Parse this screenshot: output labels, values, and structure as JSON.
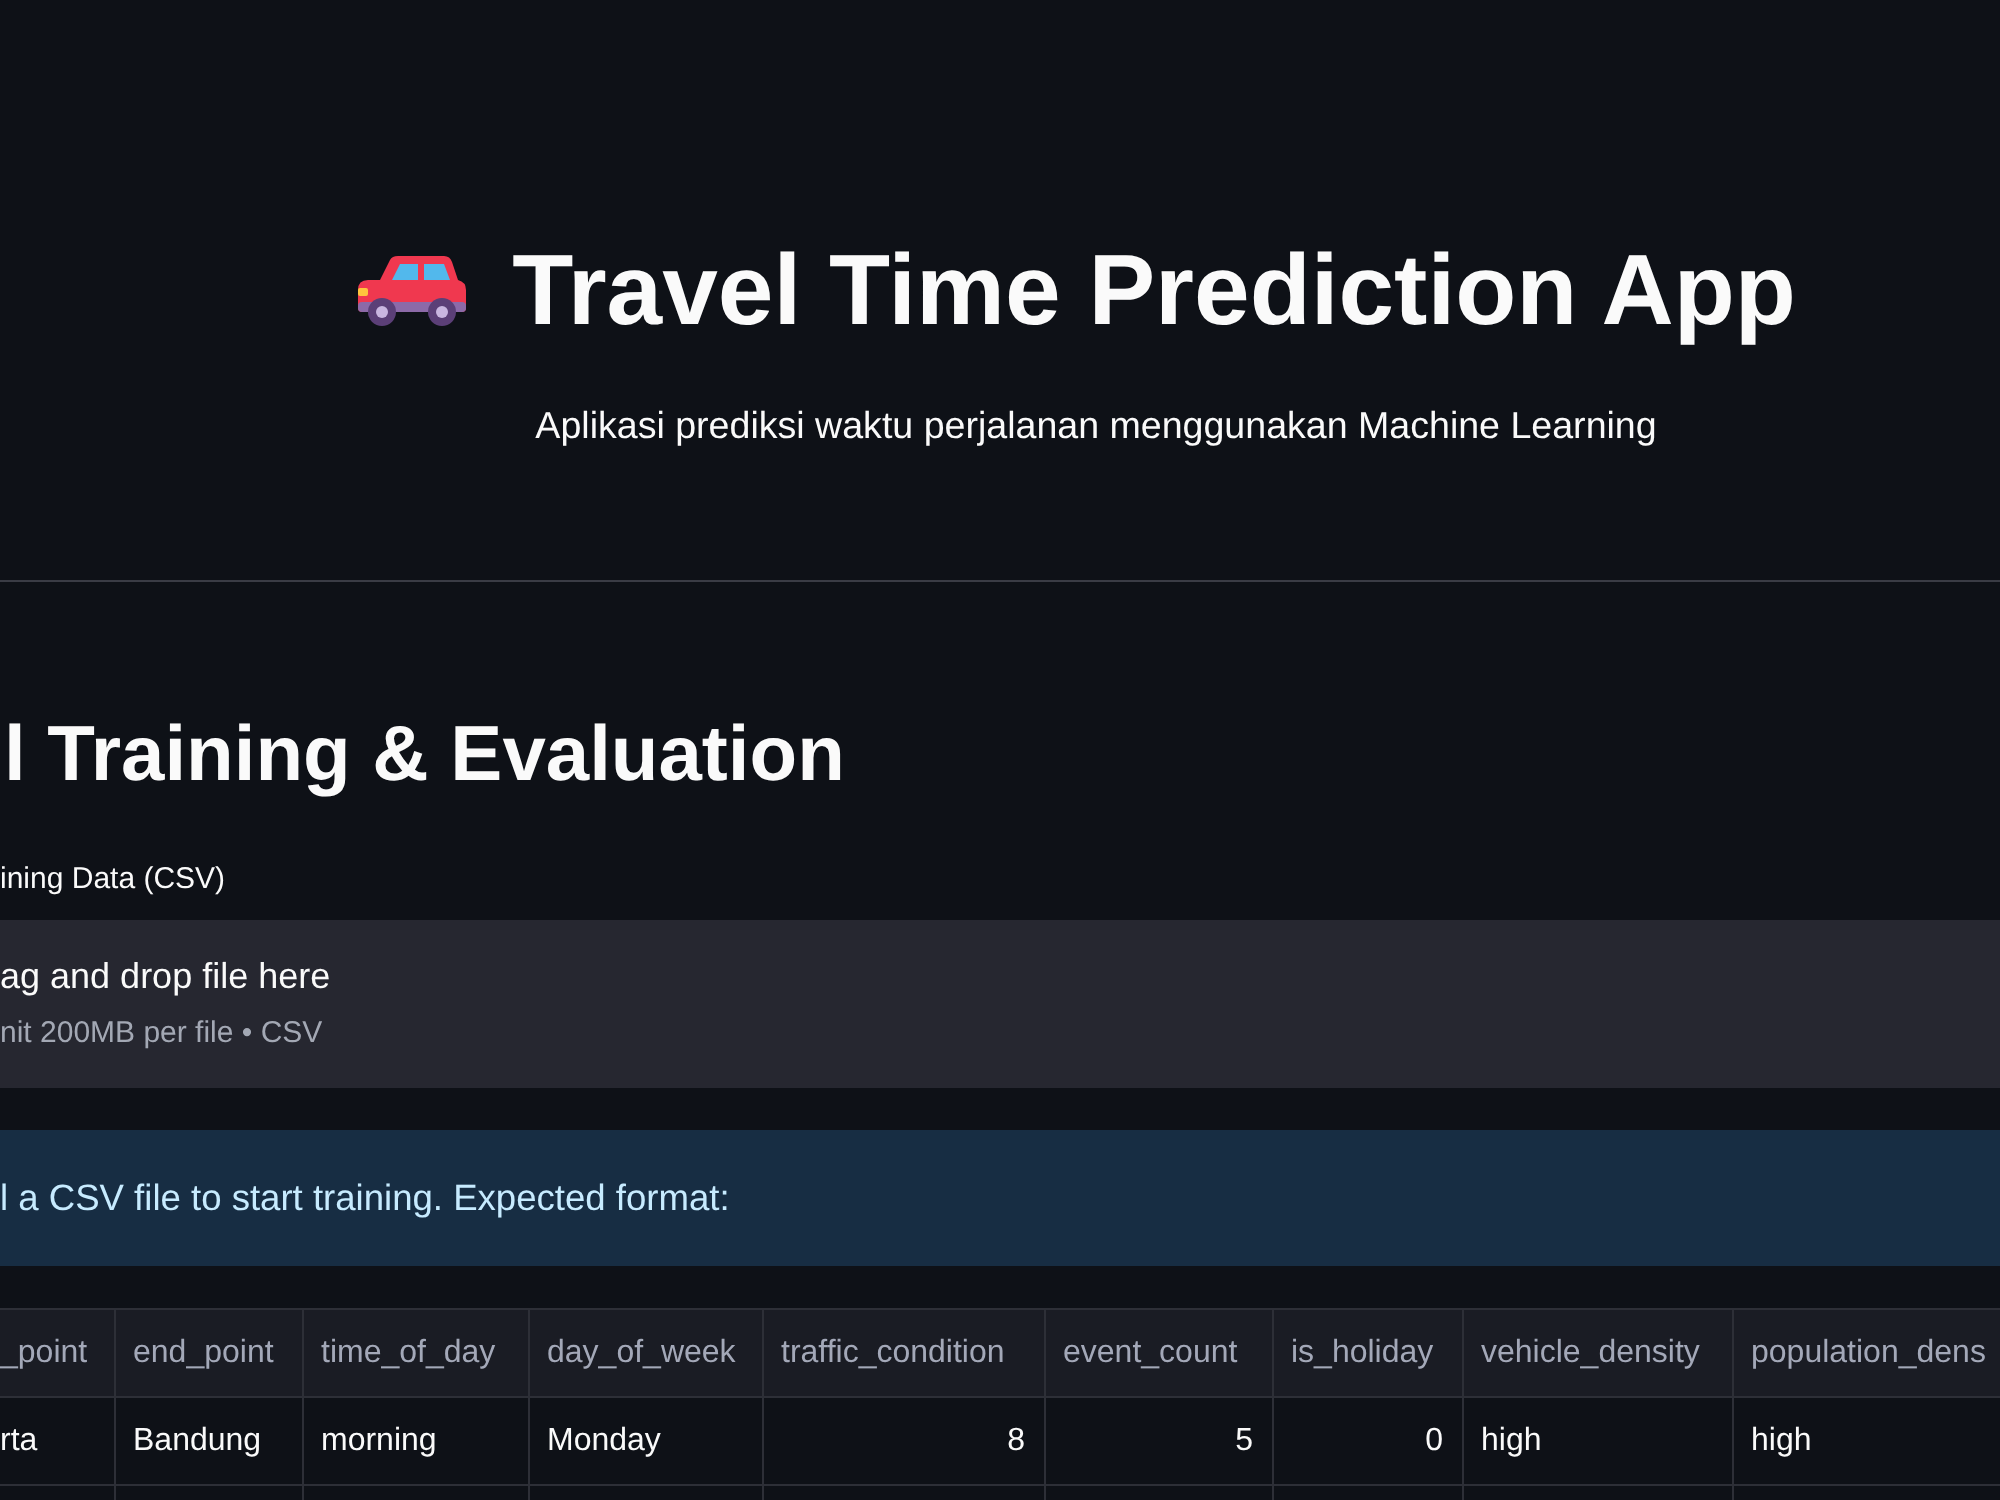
{
  "app": {
    "title": "Travel Time Prediction App",
    "subtitle": "Aplikasi prediksi waktu perjalanan menggunakan Machine Learning"
  },
  "section": {
    "heading": "l Training & Evaluation",
    "uploader": {
      "label": "ining Data (CSV)",
      "prompt": "ag and drop file here",
      "hint": "nit 200MB per file • CSV"
    },
    "info": "l a CSV file to start training. Expected format:",
    "table": {
      "columns": [
        {
          "label": "_point",
          "kind": "text"
        },
        {
          "label": "end_point",
          "kind": "text"
        },
        {
          "label": "time_of_day",
          "kind": "text"
        },
        {
          "label": "day_of_week",
          "kind": "text"
        },
        {
          "label": "traffic_condition",
          "kind": "number"
        },
        {
          "label": "event_count",
          "kind": "number"
        },
        {
          "label": "is_holiday",
          "kind": "number"
        },
        {
          "label": "vehicle_density",
          "kind": "text"
        },
        {
          "label": "population_dens",
          "kind": "text"
        }
      ],
      "rows": [
        [
          "rta",
          "Bandung",
          "morning",
          "Monday",
          "8",
          "5",
          "0",
          "high",
          "high"
        ]
      ]
    }
  }
}
